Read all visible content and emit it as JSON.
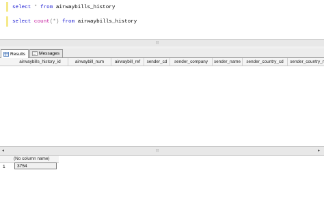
{
  "editor": {
    "lines": [
      {
        "parts": [
          {
            "t": "select",
            "c": "kw"
          },
          {
            "t": " ",
            "c": "plain"
          },
          {
            "t": "*",
            "c": "op"
          },
          {
            "t": " ",
            "c": "plain"
          },
          {
            "t": "from",
            "c": "kw"
          },
          {
            "t": " airwaybills_history",
            "c": "plain"
          }
        ]
      },
      {
        "parts": [
          {
            "t": "select",
            "c": "kw"
          },
          {
            "t": " ",
            "c": "plain"
          },
          {
            "t": "count",
            "c": "fn"
          },
          {
            "t": "(*)",
            "c": "op"
          },
          {
            "t": " ",
            "c": "plain"
          },
          {
            "t": "from",
            "c": "kw"
          },
          {
            "t": " airwaybills_history",
            "c": "plain"
          }
        ]
      }
    ],
    "scroll_grip": "⦙⦙⦙"
  },
  "tabs": [
    {
      "label": "Results",
      "icon": "results-grid-icon",
      "active": true
    },
    {
      "label": "Messages",
      "icon": "messages-icon",
      "active": false
    }
  ],
  "result1": {
    "columns": [
      "airwaybills_history_id",
      "airwaybill_num",
      "airwaybill_ref",
      "sender_cd",
      "sender_company",
      "sender_name",
      "sender_country_cd",
      "sender_country_name"
    ],
    "rows": []
  },
  "splitter_grip": "⦙⦙⦙",
  "result2": {
    "columns": [
      "(No column name)"
    ],
    "rows": [
      {
        "num": "1",
        "value": "3754"
      }
    ]
  },
  "colors": {
    "keyword": "#1b1bd2",
    "function": "#c3159b",
    "operator": "#7a7a7a",
    "gutter": "#f5e98a"
  }
}
